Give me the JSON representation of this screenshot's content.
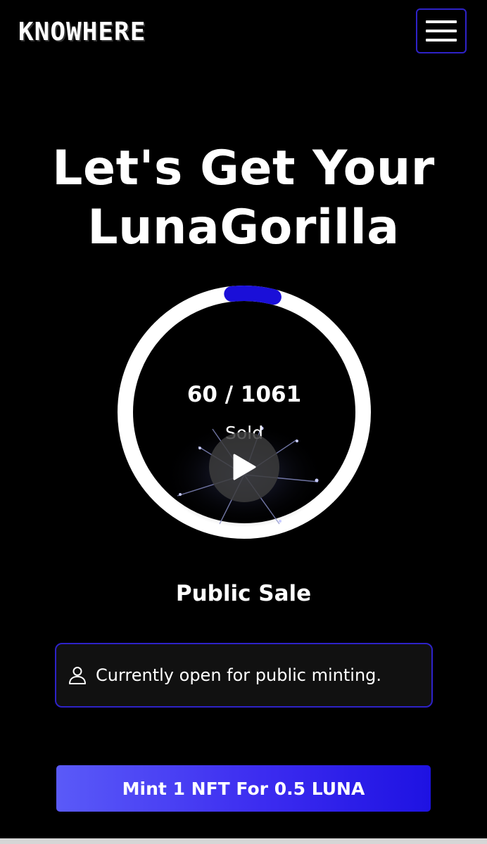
{
  "header": {
    "logo_text": "KNOWHERE",
    "menu_icon": "hamburger-menu-icon"
  },
  "hero": {
    "title_line1": "Let's Get Your",
    "title_line2": "LunaGorilla"
  },
  "progress": {
    "sold": 60,
    "total": 1061,
    "count_text": "60 / 1061",
    "label": "Sold",
    "fraction": 0.0566,
    "ring_color": "#ffffff",
    "progress_color": "#1a0fd8"
  },
  "video": {
    "play_icon": "play-icon"
  },
  "sale": {
    "phase": "Public Sale",
    "status_icon": "user-icon",
    "status_text": "Currently open for public minting."
  },
  "mint": {
    "button_label": "Mint 1 NFT For 0.5 LUNA"
  },
  "colors": {
    "accent": "#2e22c8",
    "background": "#000000",
    "mint_gradient_start": "#5a5af8",
    "mint_gradient_end": "#1e12e2"
  }
}
